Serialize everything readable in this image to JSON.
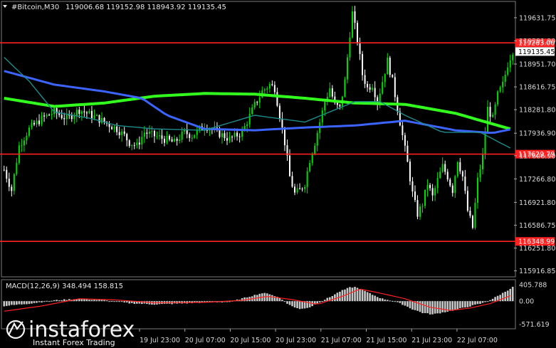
{
  "header": {
    "symbol": "#Bitcoin,M30",
    "ohlc": "119006.68 119152.98 118943.92 119135.45"
  },
  "macd_label": "MACD(12,26,9) 348.494 158.815",
  "logo": {
    "text": "instaforex",
    "sub": "Instant Forex Trading"
  },
  "colors": {
    "background": "#000000",
    "bull_candle": "#00e000",
    "bear_candle": "#ffffff",
    "level_line": "#ff2020",
    "ma_green": "#32ff1e",
    "ma_blue": "#3c64ff",
    "ma_teal": "#1e8c8c",
    "macd_hist": "#c8c8c8",
    "macd_signal": "#ff2020",
    "current_price_box": "#ffffff"
  },
  "chart_data": [
    {
      "type": "line",
      "title": "",
      "price_axis_ticks": [
        119631.75,
        119291.9,
        118951.7,
        118616.75,
        118281.8,
        117936.9,
        117606.9,
        117266.8,
        116921.8,
        116586.75,
        116251.8,
        115916.85
      ],
      "ylim": [
        115850,
        119850
      ],
      "time_axis_labels": [
        "19 Jul 23:00",
        "20 Jul 07:00",
        "20 Jul 15:00",
        "20 Jul 23:00",
        "21 Jul 07:00",
        "21 Jul 15:00",
        "21 Jul 23:00",
        "22 Jul 07:00"
      ],
      "horizontal_levels": [
        {
          "value": 119263.0,
          "label": "119263.00"
        },
        {
          "value": 117629.79,
          "label": "117629.79"
        },
        {
          "value": 116348.99,
          "label": "116348.99"
        }
      ],
      "current_price": {
        "value": 119135.45,
        "label": "119135.45"
      },
      "price_path": [
        [
          0,
          117400
        ],
        [
          3,
          117100
        ],
        [
          6,
          117750
        ],
        [
          10,
          118000
        ],
        [
          15,
          118150
        ],
        [
          20,
          118250
        ],
        [
          25,
          118150
        ],
        [
          30,
          118280
        ],
        [
          35,
          118200
        ],
        [
          40,
          118100
        ],
        [
          45,
          118000
        ],
        [
          48,
          117900
        ],
        [
          50,
          117800
        ],
        [
          53,
          117750
        ],
        [
          56,
          117950
        ],
        [
          60,
          117900
        ],
        [
          64,
          117850
        ],
        [
          68,
          117800
        ],
        [
          72,
          117950
        ],
        [
          75,
          117900
        ],
        [
          80,
          118050
        ],
        [
          85,
          117950
        ],
        [
          90,
          117850
        ],
        [
          95,
          117950
        ],
        [
          100,
          118350
        ],
        [
          103,
          118550
        ],
        [
          106,
          118650
        ],
        [
          108,
          118600
        ],
        [
          110,
          118200
        ],
        [
          112,
          117800
        ],
        [
          114,
          117300
        ],
        [
          116,
          117050
        ],
        [
          118,
          117100
        ],
        [
          120,
          117200
        ],
        [
          122,
          117550
        ],
        [
          124,
          117800
        ],
        [
          126,
          118100
        ],
        [
          128,
          118400
        ],
        [
          130,
          118600
        ],
        [
          132,
          118350
        ],
        [
          134,
          118300
        ],
        [
          136,
          118700
        ],
        [
          138,
          119400
        ],
        [
          139,
          119700
        ],
        [
          141,
          119300
        ],
        [
          143,
          118800
        ],
        [
          145,
          118600
        ],
        [
          147,
          118650
        ],
        [
          149,
          118400
        ],
        [
          151,
          118700
        ],
        [
          153,
          119000
        ],
        [
          155,
          118700
        ],
        [
          157,
          118300
        ],
        [
          159,
          117900
        ],
        [
          161,
          117500
        ],
        [
          163,
          117050
        ],
        [
          165,
          116750
        ],
        [
          167,
          116900
        ],
        [
          169,
          117200
        ],
        [
          171,
          117000
        ],
        [
          173,
          117250
        ],
        [
          175,
          117450
        ],
        [
          177,
          117300
        ],
        [
          179,
          117100
        ],
        [
          181,
          117550
        ],
        [
          183,
          117300
        ],
        [
          185,
          116800
        ],
        [
          187,
          116550
        ],
        [
          189,
          117250
        ],
        [
          191,
          117600
        ],
        [
          193,
          118300
        ],
        [
          195,
          118150
        ],
        [
          197,
          118500
        ],
        [
          199,
          118650
        ],
        [
          201,
          118950
        ],
        [
          203,
          119150
        ]
      ],
      "series": [
        {
          "name": "",
          "color_key": "ma_green",
          "points": [
            [
              0,
              118450
            ],
            [
              20,
              118330
            ],
            [
              40,
              118380
            ],
            [
              60,
              118480
            ],
            [
              80,
              118520
            ],
            [
              100,
              118510
            ],
            [
              120,
              118450
            ],
            [
              140,
              118380
            ],
            [
              160,
              118360
            ],
            [
              180,
              118230
            ],
            [
              200,
              118020
            ],
            [
              203,
              117990
            ]
          ]
        },
        {
          "name": "",
          "color_key": "ma_blue",
          "points": [
            [
              0,
              118850
            ],
            [
              20,
              118650
            ],
            [
              40,
              118550
            ],
            [
              55,
              118450
            ],
            [
              65,
              118200
            ],
            [
              80,
              118000
            ],
            [
              100,
              117980
            ],
            [
              120,
              118020
            ],
            [
              140,
              118050
            ],
            [
              160,
              118120
            ],
            [
              170,
              118050
            ],
            [
              180,
              117980
            ],
            [
              195,
              117940
            ],
            [
              203,
              118000
            ]
          ]
        },
        {
          "name": "",
          "color_key": "ma_teal",
          "points": [
            [
              0,
              119050
            ],
            [
              10,
              118700
            ],
            [
              20,
              118250
            ],
            [
              35,
              118150
            ],
            [
              45,
              118050
            ],
            [
              60,
              118000
            ],
            [
              80,
              117980
            ],
            [
              100,
              118200
            ],
            [
              120,
              118100
            ],
            [
              140,
              118400
            ],
            [
              150,
              118400
            ],
            [
              160,
              118200
            ],
            [
              175,
              117950
            ],
            [
              190,
              117950
            ],
            [
              203,
              117700
            ]
          ]
        }
      ]
    },
    {
      "type": "bar",
      "title": "MACD(12,26,9) 348.494 158.815",
      "ylim": [
        -650,
        480
      ],
      "axis_ticks": [
        405.788,
        0.0,
        -571.619
      ],
      "macd_hist_path": [
        [
          0,
          -120
        ],
        [
          10,
          -60
        ],
        [
          20,
          20
        ],
        [
          30,
          60
        ],
        [
          40,
          20
        ],
        [
          50,
          -50
        ],
        [
          60,
          -80
        ],
        [
          70,
          -60
        ],
        [
          80,
          -30
        ],
        [
          90,
          -20
        ],
        [
          100,
          150
        ],
        [
          103,
          200
        ],
        [
          106,
          180
        ],
        [
          110,
          80
        ],
        [
          114,
          -100
        ],
        [
          118,
          -200
        ],
        [
          122,
          -150
        ],
        [
          126,
          -20
        ],
        [
          130,
          100
        ],
        [
          134,
          240
        ],
        [
          138,
          340
        ],
        [
          140,
          350
        ],
        [
          143,
          280
        ],
        [
          147,
          160
        ],
        [
          151,
          60
        ],
        [
          155,
          10
        ],
        [
          159,
          -80
        ],
        [
          163,
          -200
        ],
        [
          167,
          -290
        ],
        [
          171,
          -330
        ],
        [
          175,
          -280
        ],
        [
          179,
          -230
        ],
        [
          183,
          -170
        ],
        [
          187,
          -110
        ],
        [
          191,
          -50
        ],
        [
          195,
          60
        ],
        [
          199,
          200
        ],
        [
          203,
          348
        ]
      ],
      "signal_path": [
        [
          0,
          -250
        ],
        [
          15,
          -120
        ],
        [
          30,
          60
        ],
        [
          45,
          30
        ],
        [
          60,
          -40
        ],
        [
          80,
          -30
        ],
        [
          95,
          20
        ],
        [
          105,
          120
        ],
        [
          115,
          40
        ],
        [
          125,
          -80
        ],
        [
          135,
          120
        ],
        [
          142,
          300
        ],
        [
          150,
          200
        ],
        [
          160,
          60
        ],
        [
          170,
          -150
        ],
        [
          178,
          -230
        ],
        [
          186,
          -170
        ],
        [
          194,
          -60
        ],
        [
          203,
          158
        ]
      ]
    }
  ]
}
